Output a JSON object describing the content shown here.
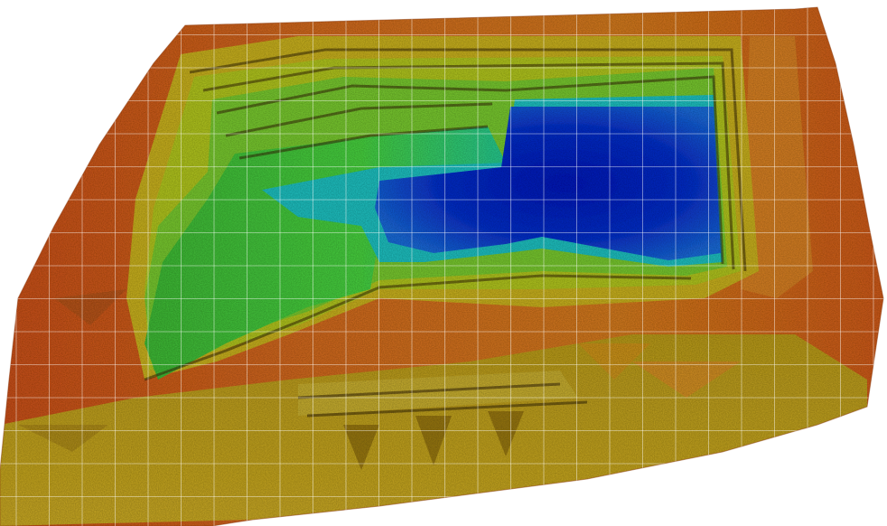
{
  "map": {
    "kind": "elevation-heatmap",
    "subject": "quarry",
    "grid_visible": true,
    "palette": {
      "background": "#ffffff",
      "highest": "#c8501a",
      "high": "#d87a20",
      "upper_mid": "#c8a820",
      "mid": "#b8c828",
      "lower_mid": "#48c838",
      "low": "#20c8a0",
      "deep": "#2090d8",
      "deepest": "#1020c0",
      "grid_line": "#ffffff"
    }
  }
}
